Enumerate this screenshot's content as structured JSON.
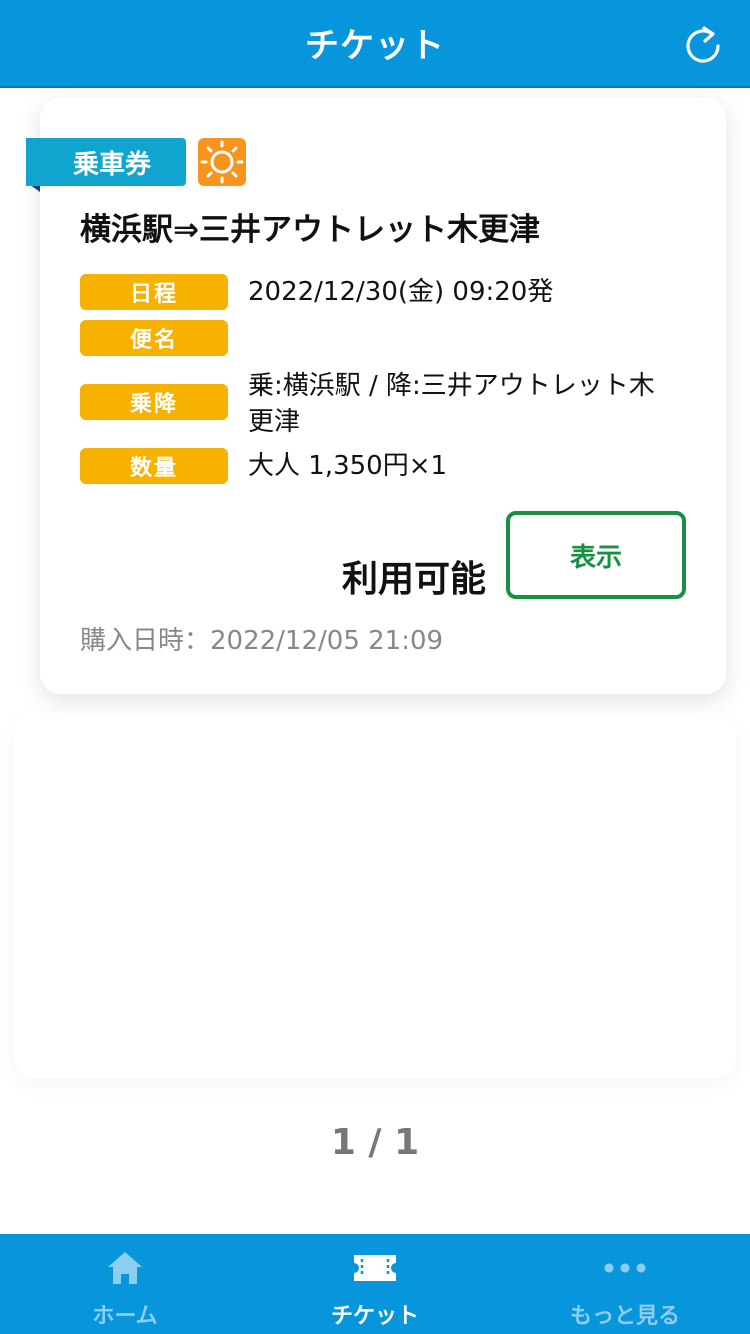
{
  "header": {
    "title": "チケット",
    "refresh_icon": "refresh-icon"
  },
  "ticket": {
    "type_label": "乗車券",
    "badge_icon": "sun-icon",
    "route": "横浜駅⇒三井アウトレット木更津",
    "fields": [
      {
        "label": "日程",
        "value": "2022/12/30(金) 09:20発"
      },
      {
        "label": "便名",
        "value": ""
      },
      {
        "label": "乗降",
        "value": "乗:横浜駅 / 降:三井アウトレット木更津"
      },
      {
        "label": "数量",
        "value": "大人 1,350円×1"
      }
    ],
    "status": "利用可能",
    "show_button": "表示",
    "purchase_datetime": "購入日時：2022/12/05 21:09"
  },
  "pager": "1 / 1",
  "bottom_nav": {
    "items": [
      {
        "label": "ホーム",
        "icon": "home-icon",
        "active": false
      },
      {
        "label": "チケット",
        "icon": "ticket-icon",
        "active": true
      },
      {
        "label": "もっと見る",
        "icon": "more-icon",
        "active": false
      }
    ]
  },
  "colors": {
    "primary": "#0796dc",
    "tag": "#f7b100",
    "ribbon": "#0fa5cf",
    "badge": "#f7941d",
    "button": "#179044"
  }
}
